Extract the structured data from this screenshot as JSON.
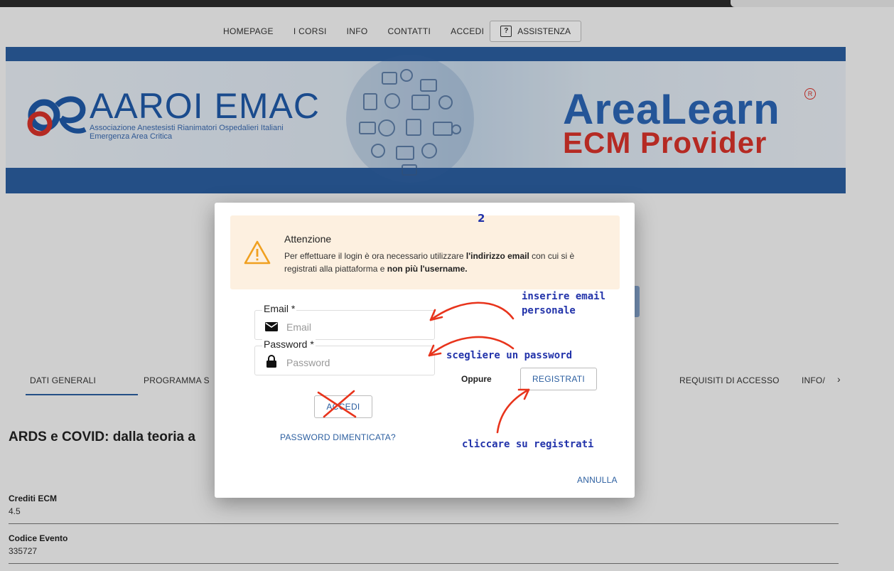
{
  "nav": {
    "homepage": "HOMEPAGE",
    "corsi": "I CORSI",
    "info": "INFO",
    "contatti": "CONTATTI",
    "accedi": "ACCEDI",
    "assistenza": "ASSISTENZA"
  },
  "banner": {
    "left_title": "AAROI EMAC",
    "left_sub1": "Associazione Anestesisti Rianimatori Ospedalieri Italiani",
    "left_sub2": "Emergenza Area Critica",
    "right_title_a": "Area",
    "right_title_b": "Learn",
    "right_reg": "R",
    "right_sub": "ECM Provider"
  },
  "tabs": {
    "dati_generali": "DATI GENERALI",
    "programma": "PROGRAMMA S",
    "requisiti": "REQUISITI DI ACCESSO",
    "info": "INFO/",
    "next": "›"
  },
  "page": {
    "title": "ARDS e COVID: dalla teoria a",
    "crediti_label": "Crediti ECM",
    "crediti_value": "4.5",
    "codice_label": "Codice Evento",
    "codice_value": "335727"
  },
  "modal": {
    "alert_title": "Attenzione",
    "alert_text_1": "Per effettuare il login è ora necessario utilizzare ",
    "alert_bold_1": "l'indirizzo email",
    "alert_text_2": " con cui si è registrati alla piattaforma e ",
    "alert_bold_2": "non più l'username.",
    "email_label": "Email *",
    "email_placeholder": "Email",
    "password_label": "Password *",
    "password_placeholder": "Password",
    "oppure": "Oppure",
    "registrati": "REGISTRATI",
    "accedi": "ACCEDI",
    "password_dimenticata": "PASSWORD DIMENTICATA?",
    "annulla": "ANNULLA"
  },
  "annotations": {
    "step": "2",
    "email_note_1": "inserire email",
    "email_note_2": "personale",
    "password_note": "scegliere un password",
    "register_note": "cliccare su registrati",
    "arrow_color": "#e8341c",
    "text_color": "#2233aa"
  },
  "colors": {
    "brand_blue": "#2c5fa0",
    "brand_red": "#d8332a",
    "alert_bg": "#fdf0e0",
    "warn_orange": "#f0a020"
  }
}
